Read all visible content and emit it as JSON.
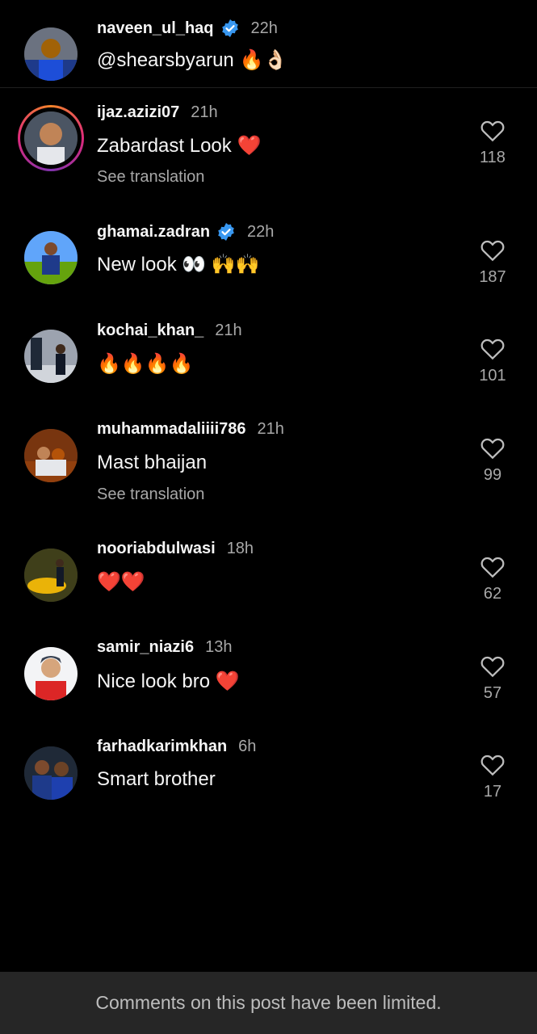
{
  "caption": {
    "username": "naveen_ul_haq",
    "time": "22h",
    "text": "@shearsbyarun 🔥👌🏻"
  },
  "comments": [
    {
      "username": "ijaz.azizi07",
      "time": "21h",
      "text": "Zabardast Look ❤️",
      "translation": "See translation",
      "likes": "118"
    },
    {
      "username": "ghamai.zadran",
      "time": "22h",
      "text": "New look 👀 🙌🙌",
      "likes": "187"
    },
    {
      "username": "kochai_khan_",
      "time": "21h",
      "text": "🔥🔥🔥🔥",
      "likes": "101"
    },
    {
      "username": "muhammadaliiii786",
      "time": "21h",
      "text": "Mast bhaijan",
      "translation": "See translation",
      "likes": "99"
    },
    {
      "username": "nooriabdulwasi",
      "time": "18h",
      "text": "❤️❤️",
      "likes": "62"
    },
    {
      "username": "samir_niazi6",
      "time": "13h",
      "text": "Nice look bro ❤️",
      "likes": "57"
    },
    {
      "username": "farhadkarimkhan",
      "time": "6h",
      "text": "Smart brother",
      "likes": "17"
    }
  ],
  "footer": {
    "text": "Comments on this post have been limited."
  },
  "colors": {
    "background": "#000000",
    "verified": "#3897f0",
    "muted": "#a8a8a8",
    "footer_bg": "#262626"
  },
  "icons": [
    "verified-badge-icon",
    "heart-outline-icon"
  ]
}
